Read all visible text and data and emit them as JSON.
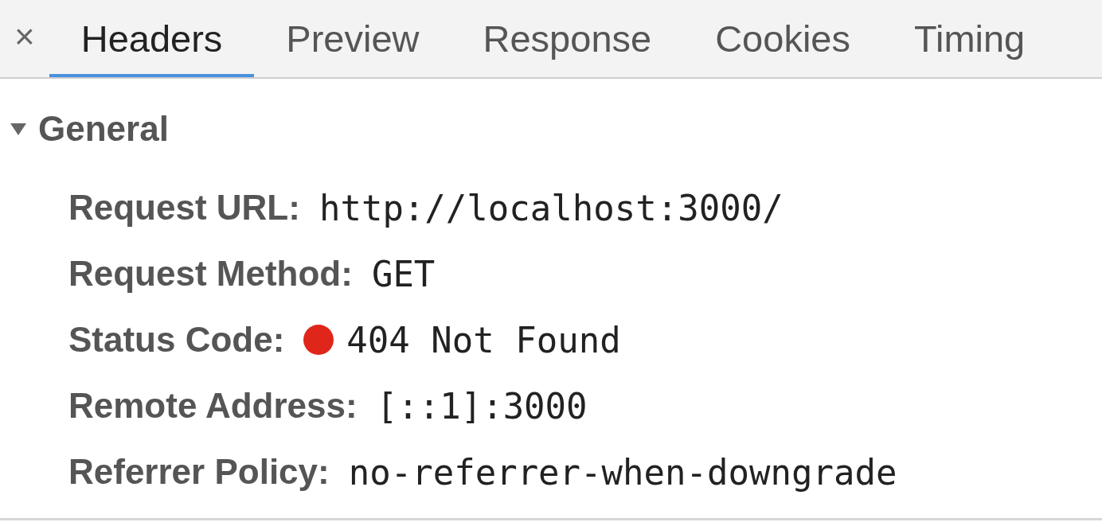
{
  "close_button": {
    "label": "×"
  },
  "tabs": [
    {
      "label": "Headers",
      "selected": true
    },
    {
      "label": "Preview",
      "selected": false
    },
    {
      "label": "Response",
      "selected": false
    },
    {
      "label": "Cookies",
      "selected": false
    },
    {
      "label": "Timing",
      "selected": false
    }
  ],
  "section": {
    "title": "General",
    "expanded": true,
    "rows": [
      {
        "kind": "text",
        "label": "Request URL:",
        "value": "http://localhost:3000/"
      },
      {
        "kind": "text",
        "label": "Request Method:",
        "value": "GET"
      },
      {
        "kind": "status",
        "label": "Status Code:",
        "value": "404 Not Found",
        "color": "#e0261b"
      },
      {
        "kind": "text",
        "label": "Remote Address:",
        "value": "[::1]:3000"
      },
      {
        "kind": "text",
        "label": "Referrer Policy:",
        "value": "no-referrer-when-downgrade"
      }
    ]
  }
}
